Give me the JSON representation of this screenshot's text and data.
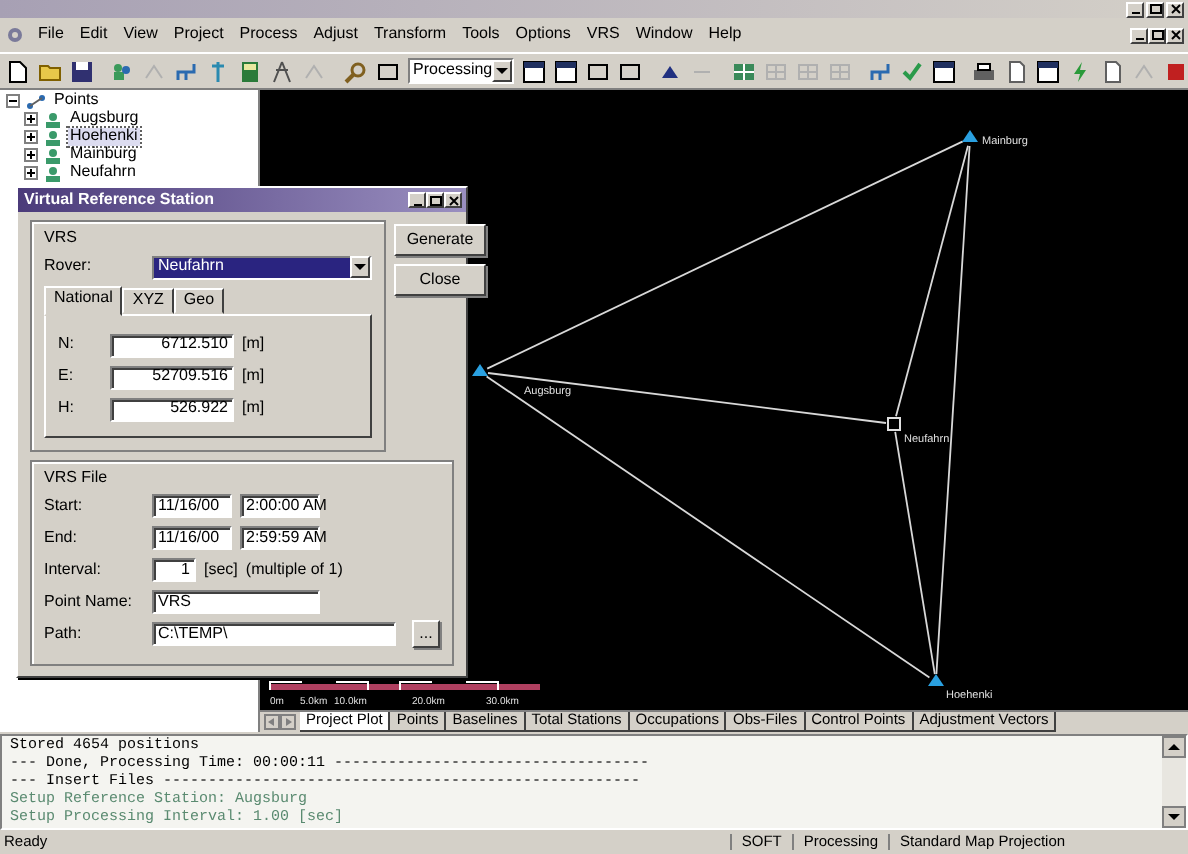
{
  "menu": [
    "File",
    "Edit",
    "View",
    "Project",
    "Process",
    "Adjust",
    "Transform",
    "Tools",
    "Options",
    "VRS",
    "Window",
    "Help"
  ],
  "toolbar": {
    "combo": "Processing"
  },
  "tree": {
    "label": "Points",
    "expanded": true,
    "children": [
      {
        "label": "Augsburg",
        "selected": false,
        "expanded": false
      },
      {
        "label": "Hoehenki",
        "selected": true,
        "expanded": false
      },
      {
        "label": "Mainburg",
        "selected": false,
        "expanded": false
      },
      {
        "label": "Neufahrn",
        "selected": false,
        "expanded": false
      }
    ]
  },
  "map": {
    "stations": [
      {
        "label": "Mainburg",
        "kind": "reference"
      },
      {
        "label": "Augsburg",
        "kind": "reference"
      },
      {
        "label": "Neufahrn",
        "kind": "virtual"
      },
      {
        "label": "Hoehenki",
        "kind": "reference"
      }
    ],
    "scale_labels": [
      "0m",
      "5.0km",
      "10.0km",
      "20.0km",
      "30.0km"
    ]
  },
  "view_tabs": [
    {
      "label": "Project Plot",
      "selected": true
    },
    {
      "label": "Points",
      "selected": false
    },
    {
      "label": "Baselines",
      "selected": false
    },
    {
      "label": "Total Stations",
      "selected": false
    },
    {
      "label": "Occupations",
      "selected": false
    },
    {
      "label": "Obs-Files",
      "selected": false
    },
    {
      "label": "Control Points",
      "selected": false
    },
    {
      "label": "Adjustment Vectors",
      "selected": false
    }
  ],
  "dialog": {
    "title": "Virtual Reference Station",
    "vrs_group": "VRS",
    "rover_label": "Rover:",
    "rover_value": "Neufahrn",
    "tabs": [
      {
        "label": "National",
        "selected": true
      },
      {
        "label": "XYZ",
        "selected": false
      },
      {
        "label": "Geo",
        "selected": false
      }
    ],
    "coords": [
      {
        "label": "N:",
        "value": "6712.510",
        "unit": "[m]"
      },
      {
        "label": "E:",
        "value": "52709.516",
        "unit": "[m]"
      },
      {
        "label": "H:",
        "value": "526.922",
        "unit": "[m]"
      }
    ],
    "buttons": [
      "Generate",
      "Close"
    ],
    "file_group": "VRS File",
    "start": {
      "label": "Start:",
      "date": "11/16/00",
      "time": "2:00:00 AM"
    },
    "end": {
      "label": "End:",
      "date": "11/16/00",
      "time": "2:59:59 AM"
    },
    "interval": {
      "label": "Interval:",
      "value": "1",
      "unit": "[sec]",
      "note": "(multiple of 1)"
    },
    "point_name": {
      "label": "Point Name:",
      "value": "VRS"
    },
    "path": {
      "label": "Path:",
      "value": "C:\\TEMP\\",
      "browse": "..."
    }
  },
  "output": [
    {
      "text": "Stored 4654 positions",
      "kind": "info"
    },
    {
      "text": "--- Done, Processing Time: 00:00:11 -----------------------------------",
      "kind": "info"
    },
    {
      "text": "--- Insert Files -----------------------------------------------------",
      "kind": "info"
    },
    {
      "text": "Setup Reference Station: Augsburg",
      "kind": "setup"
    },
    {
      "text": "Setup Processing Interval: 1.00 [sec]",
      "kind": "setup"
    }
  ],
  "status_bar": {
    "message": "Ready",
    "mode": "SOFT",
    "state": "Processing",
    "projection": "Standard Map Projection"
  }
}
